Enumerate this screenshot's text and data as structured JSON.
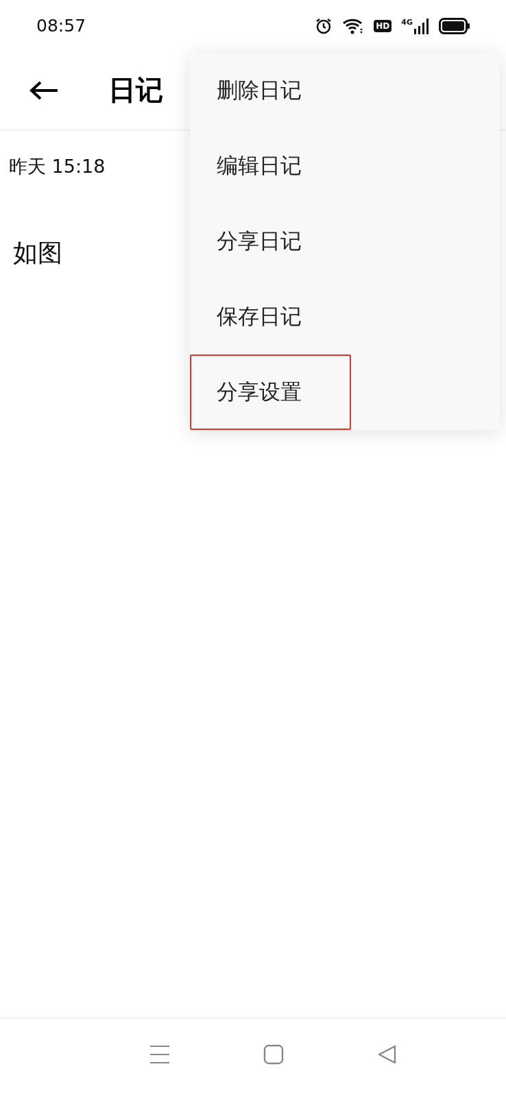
{
  "status_bar": {
    "time": "08:57",
    "hd": "HD",
    "network": "4G"
  },
  "header": {
    "title": "日记"
  },
  "diary": {
    "date": "昨天 15:18",
    "body": "如图"
  },
  "menu": {
    "items": [
      {
        "label": "删除日记",
        "highlighted": false
      },
      {
        "label": "编辑日记",
        "highlighted": false
      },
      {
        "label": "分享日记",
        "highlighted": false
      },
      {
        "label": "保存日记",
        "highlighted": false
      },
      {
        "label": "分享设置",
        "highlighted": true
      }
    ]
  }
}
